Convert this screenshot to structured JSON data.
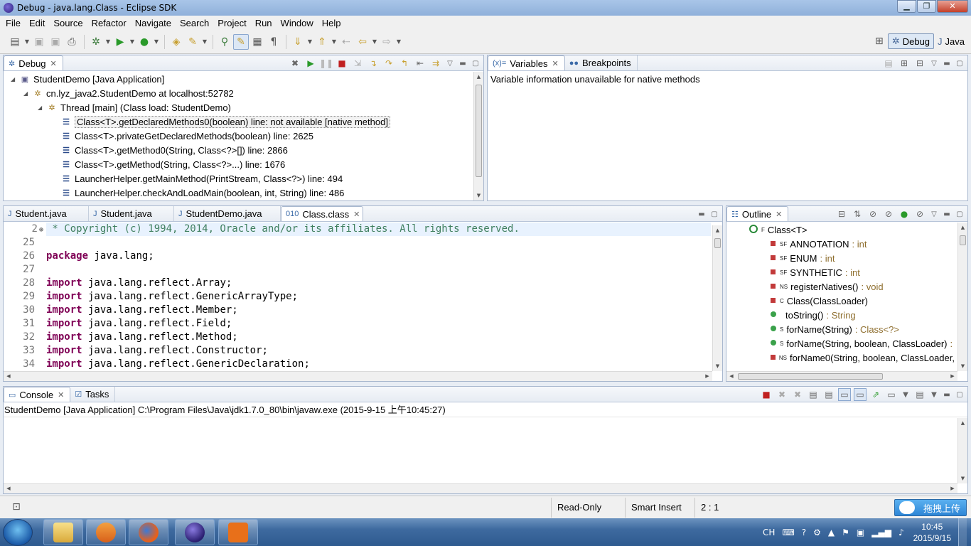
{
  "window": {
    "title": "Debug - java.lang.Class - Eclipse SDK"
  },
  "menu": [
    "File",
    "Edit",
    "Source",
    "Refactor",
    "Navigate",
    "Search",
    "Project",
    "Run",
    "Window",
    "Help"
  ],
  "perspectives": {
    "debug": "Debug",
    "java": "Java"
  },
  "debug_view": {
    "tab": "Debug",
    "items": [
      "StudentDemo [Java Application]",
      "cn.lyz_java2.StudentDemo at localhost:52782",
      "Thread [main] (Class load: StudentDemo)",
      "Class<T>.getDeclaredMethods0(boolean) line: not available [native method]",
      "Class<T>.privateGetDeclaredMethods(boolean) line: 2625",
      "Class<T>.getMethod0(String, Class<?>[]) line: 2866",
      "Class<T>.getMethod(String, Class<?>...) line: 1676",
      "LauncherHelper.getMainMethod(PrintStream, Class<?>) line: 494",
      "LauncherHelper.checkAndLoadMain(boolean, int, String) line: 486"
    ]
  },
  "variables_view": {
    "tab_variables": "Variables",
    "tab_breakpoints": "Breakpoints",
    "message": "Variable information unavailable for native methods"
  },
  "editor": {
    "tabs": [
      "Student.java",
      "Student.java",
      "StudentDemo.java",
      "Class.class"
    ],
    "lines": [
      {
        "num": "2",
        "text": " * Copyright (c) 1994, 2014, Oracle and/or its affiliates. All rights reserved."
      },
      {
        "num": "25",
        "text": ""
      },
      {
        "num": "26",
        "kw": "package",
        "text": " java.lang;"
      },
      {
        "num": "27",
        "text": ""
      },
      {
        "num": "28",
        "kw": "import",
        "text": " java.lang.reflect.Array;"
      },
      {
        "num": "29",
        "kw": "import",
        "text": " java.lang.reflect.GenericArrayType;"
      },
      {
        "num": "30",
        "kw": "import",
        "text": " java.lang.reflect.Member;"
      },
      {
        "num": "31",
        "kw": "import",
        "text": " java.lang.reflect.Field;"
      },
      {
        "num": "32",
        "kw": "import",
        "text": " java.lang.reflect.Method;"
      },
      {
        "num": "33",
        "kw": "import",
        "text": " java.lang.reflect.Constructor;"
      },
      {
        "num": "34",
        "kw": "import",
        "text": " java.lang.reflect.GenericDeclaration;"
      }
    ]
  },
  "outline": {
    "tab": "Outline",
    "items": [
      {
        "name": "Class<T>",
        "type": "",
        "sup": "F"
      },
      {
        "name": "ANNOTATION",
        "type": ": int",
        "sup": "SF"
      },
      {
        "name": "ENUM",
        "type": ": int",
        "sup": "SF"
      },
      {
        "name": "SYNTHETIC",
        "type": ": int",
        "sup": "SF"
      },
      {
        "name": "registerNatives()",
        "type": ": void",
        "sup": "NS"
      },
      {
        "name": "Class(ClassLoader)",
        "type": "",
        "sup": "C"
      },
      {
        "name": "toString()",
        "type": ": String",
        "sup": ""
      },
      {
        "name": "forName(String)",
        "type": ": Class<?>",
        "sup": "S"
      },
      {
        "name": "forName(String, boolean, ClassLoader)",
        "type": ":",
        "sup": "S"
      },
      {
        "name": "forName0(String, boolean, ClassLoader,",
        "type": "",
        "sup": "NS"
      }
    ]
  },
  "console": {
    "tab_console": "Console",
    "tab_tasks": "Tasks",
    "header": "StudentDemo [Java Application] C:\\Program Files\\Java\\jdk1.7.0_80\\bin\\javaw.exe (2015-9-15 上午10:45:27)"
  },
  "status": {
    "readonly": "Read-Only",
    "insert": "Smart Insert",
    "position": "2 : 1",
    "upload": "拖拽上传"
  },
  "taskbar": {
    "lang": "CH",
    "time": "10:45",
    "date": "2015/9/15"
  },
  "colors": {
    "keyword": "#7f0055",
    "comment": "#3f7f5f",
    "type": "#8e6e2e"
  }
}
